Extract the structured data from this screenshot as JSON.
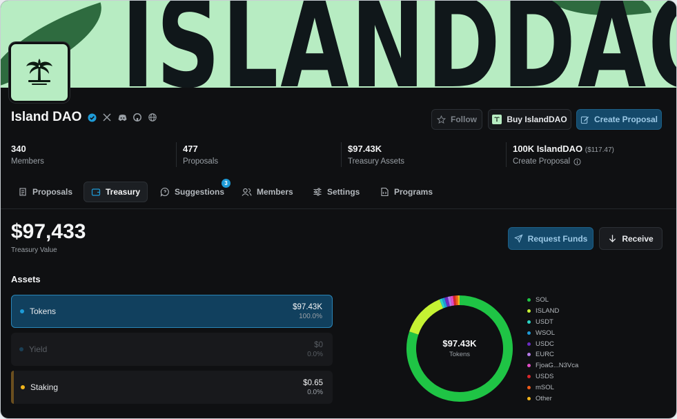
{
  "banner": {
    "text": "ISLANDDAO"
  },
  "dao": {
    "name": "Island DAO"
  },
  "header": {
    "follow_label": "Follow",
    "buy_label": "Buy IslandDAO",
    "create_label": "Create Proposal"
  },
  "stats": [
    {
      "value": "340",
      "label": "Members"
    },
    {
      "value": "477",
      "label": "Proposals"
    },
    {
      "value": "$97.43K",
      "label": "Treasury Assets"
    },
    {
      "value": "100K IslandDAO",
      "sub": "($117.47)",
      "label": "Create Proposal"
    }
  ],
  "tabs": [
    {
      "label": "Proposals"
    },
    {
      "label": "Treasury"
    },
    {
      "label": "Suggestions",
      "badge": "3"
    },
    {
      "label": "Members"
    },
    {
      "label": "Settings"
    },
    {
      "label": "Programs"
    }
  ],
  "treasury": {
    "value": "$97,433",
    "value_label": "Treasury Value",
    "request_label": "Request Funds",
    "receive_label": "Receive",
    "assets_heading": "Assets"
  },
  "assets": [
    {
      "name": "Tokens",
      "amount": "$97.43K",
      "percent": "100.0%",
      "color": "#1e9bd7"
    },
    {
      "name": "Yield",
      "amount": "$0",
      "percent": "0.0%",
      "color": "#1b3f55"
    },
    {
      "name": "Staking",
      "amount": "$0.65",
      "percent": "0.0%",
      "color": "#f2b51c"
    }
  ],
  "chart_data": {
    "type": "pie",
    "center_value": "$97.43K",
    "center_label": "Tokens",
    "categories": [
      "SOL",
      "ISLAND",
      "USDT",
      "WSOL",
      "USDC",
      "EURC",
      "FjoaG...N3Vca",
      "USDS",
      "mSOL",
      "Other"
    ],
    "values": [
      80.2,
      13.6,
      0.8,
      0.8,
      1.0,
      0.8,
      0.8,
      0.7,
      0.7,
      0.6
    ],
    "colors": [
      "#1fc445",
      "#c5f233",
      "#2ad4c4",
      "#1e9bd7",
      "#6a2bc2",
      "#b57be8",
      "#e24cc7",
      "#d8262b",
      "#f05a1a",
      "#f2b51c"
    ]
  }
}
